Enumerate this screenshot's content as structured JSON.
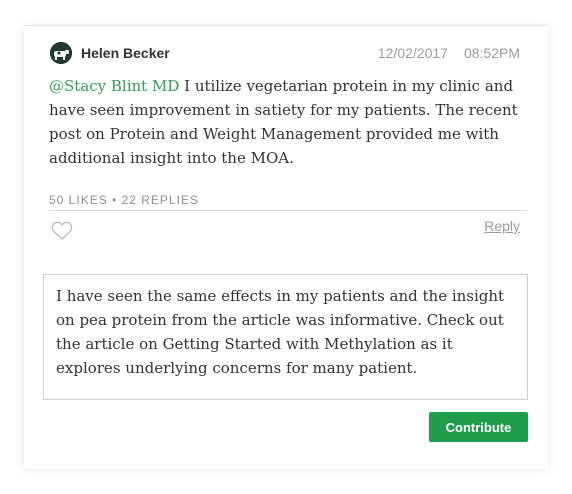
{
  "comment": {
    "author": "Helen Becker",
    "date": "12/02/2017",
    "time": "08:52PM",
    "mention": "@Stacy Blint MD",
    "text": " I utilize vegetarian protein in my clinic and have seen improvement in satiety for my patients. The recent post on Protein and Weight Management provided me with additional insight into the MOA.",
    "likes": "50 LIKES",
    "replies": "22 REPLIES",
    "separator": " • ",
    "like_icon": "heart-icon",
    "reply_label": "Reply"
  },
  "reply_box": {
    "value": "I have seen the same effects in my patients and the insight on pea protein from the article was informative. Check out the article on Getting Started with Methylation as it explores underlying concerns for many patient."
  },
  "actions": {
    "contribute_label": "Contribute"
  },
  "colors": {
    "accent": "#1e9e4d",
    "mention": "#2e9e55",
    "muted": "#9b9b9b",
    "text": "#333333"
  }
}
